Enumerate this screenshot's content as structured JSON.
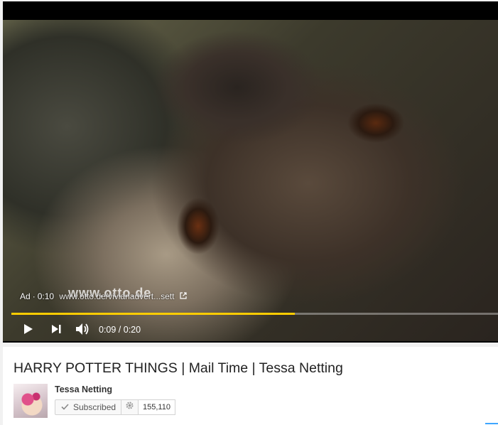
{
  "player": {
    "ad_prefix": "Ad",
    "ad_time": "0:10",
    "ad_url": "www.otto.de/vivianadvert...sett",
    "watermark": "www.otto.de",
    "progress_fraction": 0.583,
    "time": "0:09 / 0:20",
    "colors": {
      "progress": "#ffcc00",
      "background": "#000000"
    }
  },
  "video": {
    "title": "HARRY POTTER THINGS | Mail Time | Tessa Netting"
  },
  "channel": {
    "name": "Tessa Netting",
    "subscribe_label": "Subscribed",
    "subscriber_count": "155,110"
  },
  "icons": {
    "play": "play-icon",
    "next": "next-icon",
    "volume": "volume-icon",
    "check": "check-icon",
    "settings": "gear-icon",
    "external": "external-link-icon"
  }
}
